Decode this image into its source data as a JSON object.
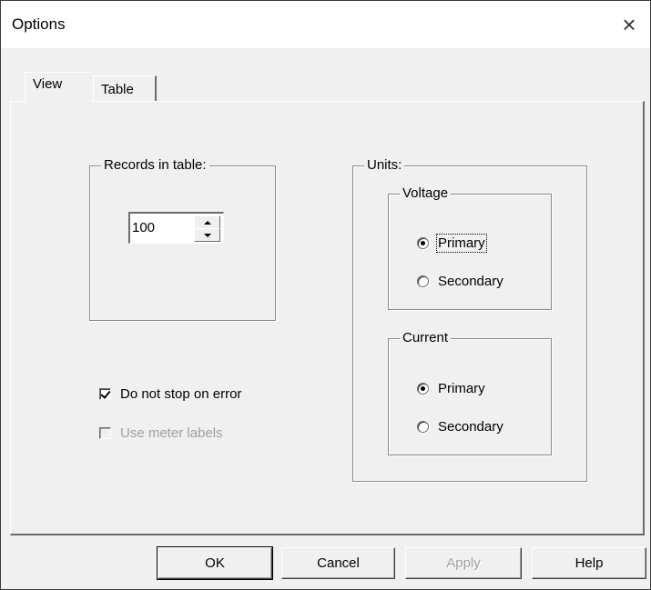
{
  "window": {
    "title": "Options",
    "close_icon": "×"
  },
  "tabs": [
    {
      "label": "View",
      "active": true
    },
    {
      "label": "Table",
      "active": false
    }
  ],
  "records": {
    "group_label": "Records in table:",
    "value": "100"
  },
  "options": {
    "stop_on_error": {
      "label": "Do not stop on error",
      "checked": true,
      "enabled": true
    },
    "meter_labels": {
      "label": "Use meter labels",
      "checked": false,
      "enabled": false
    }
  },
  "units": {
    "group_label": "Units:",
    "voltage": {
      "group_label": "Voltage",
      "primary_label": "Primary",
      "secondary_label": "Secondary",
      "selected": "Primary"
    },
    "current": {
      "group_label": "Current",
      "primary_label": "Primary",
      "secondary_label": "Secondary",
      "selected": "Primary"
    }
  },
  "buttons": {
    "ok": "OK",
    "cancel": "Cancel",
    "apply": "Apply",
    "help": "Help"
  }
}
